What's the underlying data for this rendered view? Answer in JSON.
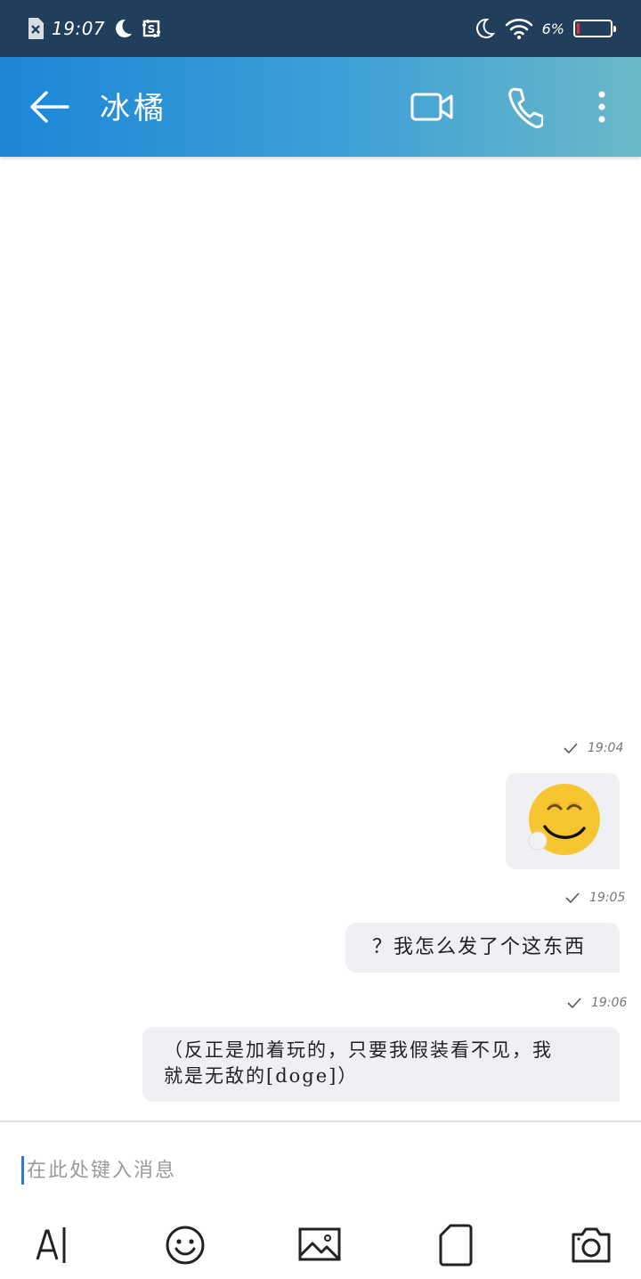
{
  "status_bar": {
    "time": "19:07",
    "battery_percent_label": "6%",
    "battery_level": 0.06,
    "battery_color": "#e0303a",
    "icons": [
      "sim-x-icon",
      "moon-icon",
      "screenshot-icon",
      "moon-icon",
      "wifi-icon",
      "battery-icon"
    ]
  },
  "header": {
    "title": "冰橘",
    "icons": [
      "back-arrow-icon",
      "video-call-icon",
      "phone-call-icon",
      "more-vertical-icon"
    ],
    "gradient_colors": [
      "#1c87d8",
      "#6bb8c8"
    ]
  },
  "messages": [
    {
      "time": "19:04",
      "type": "sticker",
      "sticker": "smiling-emoji-sticker-icon"
    },
    {
      "time": "19:05",
      "type": "text",
      "text": "？我怎么发了个这东西"
    },
    {
      "type": "text",
      "time": "19:06",
      "text_line1": "（反正是加着玩的，只要我假装看不见，我",
      "text_line2": "就是无敌的[doge]）"
    }
  ],
  "composer": {
    "placeholder": "在此处键入消息",
    "value": "",
    "tools": [
      "text-format-icon",
      "emoji-icon",
      "image-icon",
      "file-icon",
      "camera-icon"
    ]
  }
}
